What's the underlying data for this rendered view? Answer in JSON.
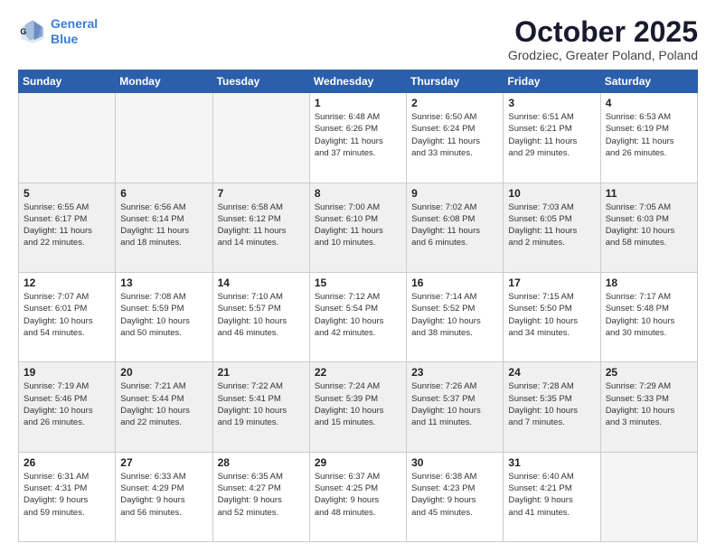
{
  "logo": {
    "line1": "General",
    "line2": "Blue"
  },
  "title": "October 2025",
  "subtitle": "Grodziec, Greater Poland, Poland",
  "days_header": [
    "Sunday",
    "Monday",
    "Tuesday",
    "Wednesday",
    "Thursday",
    "Friday",
    "Saturday"
  ],
  "weeks": [
    {
      "shaded": false,
      "days": [
        {
          "num": "",
          "content": ""
        },
        {
          "num": "",
          "content": ""
        },
        {
          "num": "",
          "content": ""
        },
        {
          "num": "1",
          "content": "Sunrise: 6:48 AM\nSunset: 6:26 PM\nDaylight: 11 hours\nand 37 minutes."
        },
        {
          "num": "2",
          "content": "Sunrise: 6:50 AM\nSunset: 6:24 PM\nDaylight: 11 hours\nand 33 minutes."
        },
        {
          "num": "3",
          "content": "Sunrise: 6:51 AM\nSunset: 6:21 PM\nDaylight: 11 hours\nand 29 minutes."
        },
        {
          "num": "4",
          "content": "Sunrise: 6:53 AM\nSunset: 6:19 PM\nDaylight: 11 hours\nand 26 minutes."
        }
      ]
    },
    {
      "shaded": true,
      "days": [
        {
          "num": "5",
          "content": "Sunrise: 6:55 AM\nSunset: 6:17 PM\nDaylight: 11 hours\nand 22 minutes."
        },
        {
          "num": "6",
          "content": "Sunrise: 6:56 AM\nSunset: 6:14 PM\nDaylight: 11 hours\nand 18 minutes."
        },
        {
          "num": "7",
          "content": "Sunrise: 6:58 AM\nSunset: 6:12 PM\nDaylight: 11 hours\nand 14 minutes."
        },
        {
          "num": "8",
          "content": "Sunrise: 7:00 AM\nSunset: 6:10 PM\nDaylight: 11 hours\nand 10 minutes."
        },
        {
          "num": "9",
          "content": "Sunrise: 7:02 AM\nSunset: 6:08 PM\nDaylight: 11 hours\nand 6 minutes."
        },
        {
          "num": "10",
          "content": "Sunrise: 7:03 AM\nSunset: 6:05 PM\nDaylight: 11 hours\nand 2 minutes."
        },
        {
          "num": "11",
          "content": "Sunrise: 7:05 AM\nSunset: 6:03 PM\nDaylight: 10 hours\nand 58 minutes."
        }
      ]
    },
    {
      "shaded": false,
      "days": [
        {
          "num": "12",
          "content": "Sunrise: 7:07 AM\nSunset: 6:01 PM\nDaylight: 10 hours\nand 54 minutes."
        },
        {
          "num": "13",
          "content": "Sunrise: 7:08 AM\nSunset: 5:59 PM\nDaylight: 10 hours\nand 50 minutes."
        },
        {
          "num": "14",
          "content": "Sunrise: 7:10 AM\nSunset: 5:57 PM\nDaylight: 10 hours\nand 46 minutes."
        },
        {
          "num": "15",
          "content": "Sunrise: 7:12 AM\nSunset: 5:54 PM\nDaylight: 10 hours\nand 42 minutes."
        },
        {
          "num": "16",
          "content": "Sunrise: 7:14 AM\nSunset: 5:52 PM\nDaylight: 10 hours\nand 38 minutes."
        },
        {
          "num": "17",
          "content": "Sunrise: 7:15 AM\nSunset: 5:50 PM\nDaylight: 10 hours\nand 34 minutes."
        },
        {
          "num": "18",
          "content": "Sunrise: 7:17 AM\nSunset: 5:48 PM\nDaylight: 10 hours\nand 30 minutes."
        }
      ]
    },
    {
      "shaded": true,
      "days": [
        {
          "num": "19",
          "content": "Sunrise: 7:19 AM\nSunset: 5:46 PM\nDaylight: 10 hours\nand 26 minutes."
        },
        {
          "num": "20",
          "content": "Sunrise: 7:21 AM\nSunset: 5:44 PM\nDaylight: 10 hours\nand 22 minutes."
        },
        {
          "num": "21",
          "content": "Sunrise: 7:22 AM\nSunset: 5:41 PM\nDaylight: 10 hours\nand 19 minutes."
        },
        {
          "num": "22",
          "content": "Sunrise: 7:24 AM\nSunset: 5:39 PM\nDaylight: 10 hours\nand 15 minutes."
        },
        {
          "num": "23",
          "content": "Sunrise: 7:26 AM\nSunset: 5:37 PM\nDaylight: 10 hours\nand 11 minutes."
        },
        {
          "num": "24",
          "content": "Sunrise: 7:28 AM\nSunset: 5:35 PM\nDaylight: 10 hours\nand 7 minutes."
        },
        {
          "num": "25",
          "content": "Sunrise: 7:29 AM\nSunset: 5:33 PM\nDaylight: 10 hours\nand 3 minutes."
        }
      ]
    },
    {
      "shaded": false,
      "days": [
        {
          "num": "26",
          "content": "Sunrise: 6:31 AM\nSunset: 4:31 PM\nDaylight: 9 hours\nand 59 minutes."
        },
        {
          "num": "27",
          "content": "Sunrise: 6:33 AM\nSunset: 4:29 PM\nDaylight: 9 hours\nand 56 minutes."
        },
        {
          "num": "28",
          "content": "Sunrise: 6:35 AM\nSunset: 4:27 PM\nDaylight: 9 hours\nand 52 minutes."
        },
        {
          "num": "29",
          "content": "Sunrise: 6:37 AM\nSunset: 4:25 PM\nDaylight: 9 hours\nand 48 minutes."
        },
        {
          "num": "30",
          "content": "Sunrise: 6:38 AM\nSunset: 4:23 PM\nDaylight: 9 hours\nand 45 minutes."
        },
        {
          "num": "31",
          "content": "Sunrise: 6:40 AM\nSunset: 4:21 PM\nDaylight: 9 hours\nand 41 minutes."
        },
        {
          "num": "",
          "content": ""
        }
      ]
    }
  ]
}
